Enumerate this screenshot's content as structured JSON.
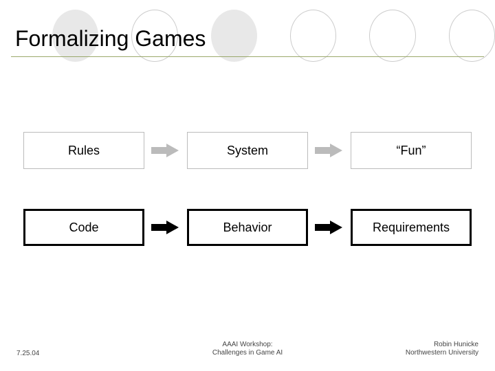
{
  "title": "Formalizing Games",
  "rows": [
    {
      "style": "light",
      "cells": [
        "Rules",
        "System",
        "“Fun”"
      ]
    },
    {
      "style": "bold",
      "cells": [
        "Code",
        "Behavior",
        "Requirements"
      ]
    }
  ],
  "footer": {
    "date": "7.25.04",
    "center_line1": "AAAI Workshop:",
    "center_line2": "Challenges in Game AI",
    "right_line1": "Robin Hunicke",
    "right_line2": "Northwestern University"
  }
}
